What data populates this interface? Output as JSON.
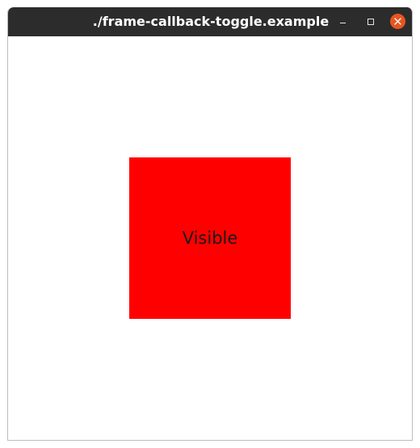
{
  "window": {
    "title": "./frame-callback-toggle.example"
  },
  "titlebar_buttons": {
    "minimize_icon": "minimize-icon",
    "maximize_icon": "maximize-icon",
    "close_icon": "close-icon"
  },
  "content": {
    "square_label": "Visible",
    "square_color": "#ff0000"
  },
  "colors": {
    "titlebar": "#2c2c2c",
    "close_button": "#e9541f"
  }
}
